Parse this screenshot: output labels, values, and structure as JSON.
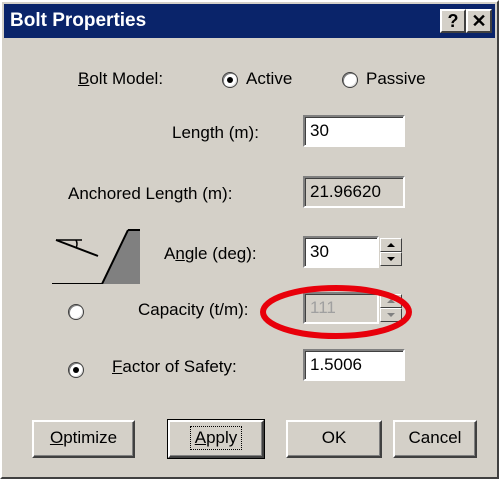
{
  "window": {
    "title": "Bolt Properties",
    "help_button": "?",
    "close_button": "✕"
  },
  "bolt_model": {
    "label_first": "B",
    "label_rest": "olt Model:",
    "active_label": "Active",
    "passive_label": "Passive",
    "selected": "Active"
  },
  "length": {
    "label": "Length (m):",
    "value": "30"
  },
  "anchored_length": {
    "label": "Anchored Length (m):",
    "value": "21.96620"
  },
  "angle": {
    "label_pre": "A",
    "label_u": "n",
    "label_rest": "gle (deg):",
    "value": "30"
  },
  "capacity": {
    "label": "Capacity (t/m):",
    "value": "111",
    "enabled": false
  },
  "factor_of_safety": {
    "label_u": "F",
    "label_rest": "actor of Safety:",
    "value": "1.5006"
  },
  "selected_mode": "Factor of Safety",
  "buttons": {
    "optimize_u": "O",
    "optimize_rest": "ptimize",
    "apply_u": "A",
    "apply_rest": "pply",
    "ok": "OK",
    "cancel": "Cancel"
  },
  "colors": {
    "titlebar": "#0a246a",
    "face": "#d4d0c8",
    "annotation": "#e8000b",
    "slope_fill": "#808080"
  },
  "icons": {
    "slope": "slope-anchor-icon",
    "spinner": "spin-arrows-icon"
  }
}
